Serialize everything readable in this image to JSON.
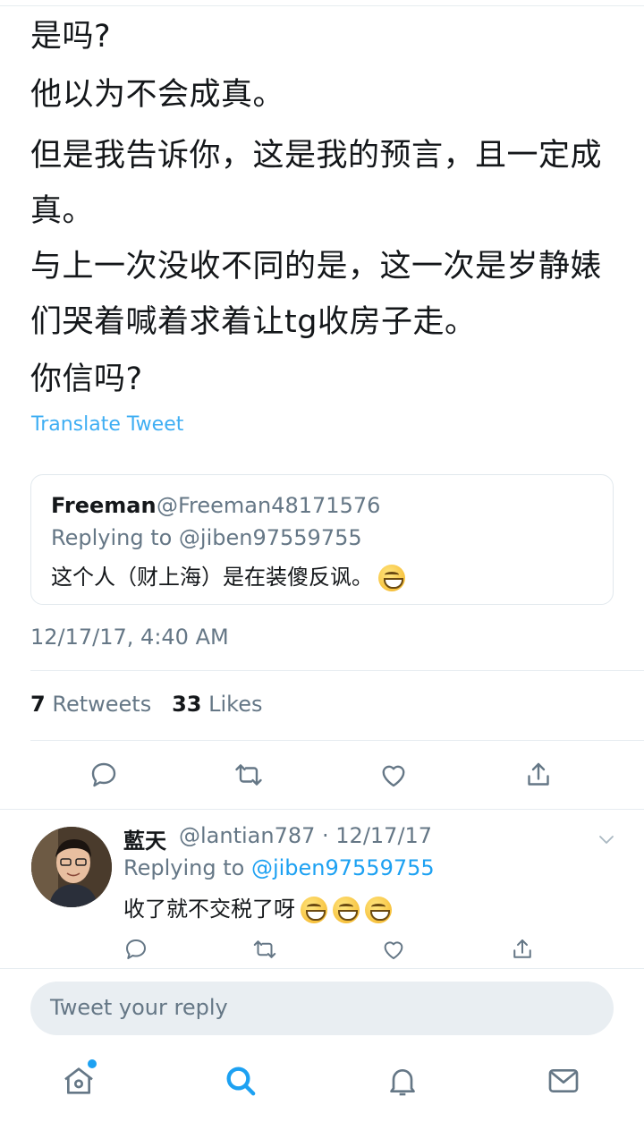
{
  "tweet": {
    "lines": [
      "是吗?",
      "他以为不会成真。",
      "但是我告诉你，这是我的预言，且一定成真。",
      "与上一次没收不同的是，这一次是岁静婊们哭着喊着求着让tg收房子走。",
      "你信吗?"
    ],
    "translate_label": "Translate Tweet",
    "timestamp": "12/17/17, 4:40 AM",
    "retweets_count": "7",
    "retweets_label": "Retweets",
    "likes_count": "33",
    "likes_label": "Likes"
  },
  "quoted": {
    "name": "Freeman",
    "handle": "@Freeman48171576",
    "replying_to": "Replying to @jiben97559755",
    "text": "这个人（财上海）是在装傻反讽。"
  },
  "reply": {
    "name": "藍天",
    "meta": "@lantian787 · 12/17/17",
    "replying_prefix": "Replying to ",
    "replying_handle": "@jiben97559755",
    "text": "收了就不交税了呀"
  },
  "compose": {
    "placeholder": "Tweet your reply"
  },
  "icons": {
    "reply": "reply-icon",
    "retweet": "retweet-icon",
    "like": "heart-icon",
    "share": "share-icon",
    "home": "home-icon",
    "search": "search-icon",
    "notifications": "bell-icon",
    "messages": "mail-icon"
  },
  "colors": {
    "accent": "#1da1f2",
    "muted": "#657786",
    "text": "#14171a"
  }
}
